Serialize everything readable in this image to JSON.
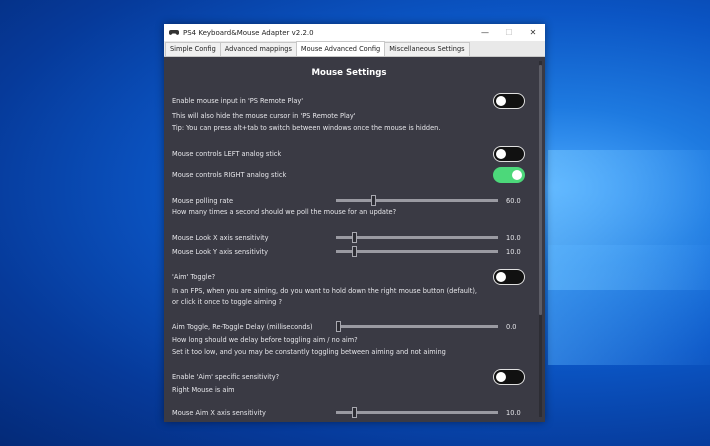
{
  "window": {
    "title": "PS4 Keyboard&Mouse Adapter v2.2.0",
    "controls": {
      "minimize": "—",
      "maximize": "☐",
      "close": "✕"
    }
  },
  "tabs": [
    {
      "label": "Simple Config"
    },
    {
      "label": "Advanced mappings"
    },
    {
      "label": "Mouse Advanced Config"
    },
    {
      "label": "Miscellaneous Settings"
    }
  ],
  "active_tab": "Mouse Advanced Config",
  "section": {
    "title": "Mouse Settings"
  },
  "settings": {
    "enable_mouse": {
      "label": "Enable mouse input in 'PS Remote Play'",
      "on": false
    },
    "hide_cursor_note": "This will also hide the mouse cursor in 'PS Remote Play'",
    "tip": "Tip: You can press alt+tab to switch between windows once the mouse is hidden.",
    "left_stick": {
      "label": "Mouse controls LEFT analog stick",
      "on": false
    },
    "right_stick": {
      "label": "Mouse controls RIGHT analog stick",
      "on": true
    },
    "polling_rate": {
      "label": "Mouse polling rate",
      "value": "60.0",
      "fraction": 0.22
    },
    "polling_desc": "How many times a second should we poll the mouse for an update?",
    "look_x": {
      "label": "Mouse Look X axis sensitivity",
      "value": "10.0",
      "fraction": 0.1
    },
    "look_y": {
      "label": "Mouse Look Y axis sensitivity",
      "value": "10.0",
      "fraction": 0.1
    },
    "aim_toggle": {
      "label": "'Aim' Toggle?",
      "on": false
    },
    "aim_toggle_desc1": "In an FPS, when you are aiming, do you want to hold down the right mouse button (default),",
    "aim_toggle_desc2": "or click it once to toggle aiming ?",
    "retoggle_delay": {
      "label": "Aim Toggle, Re-Toggle Delay (milliseconds)",
      "value": "0.0",
      "fraction": 0.0
    },
    "retoggle_desc1": "How long should we delay before toggling aim / no aim?",
    "retoggle_desc2": "Set it too low, and you may be constantly toggling between aiming and not aiming",
    "aim_sensitivity": {
      "label": "Enable 'Aim' specific sensitivity?",
      "on": false
    },
    "aim_sens_desc": "Right Mouse is aim",
    "aim_x": {
      "label": "Mouse Aim X axis sensitivity",
      "value": "10.0",
      "fraction": 0.1
    }
  },
  "colors": {
    "toggle_on": "#4cd87a",
    "panel_bg": "#3a3a44"
  }
}
